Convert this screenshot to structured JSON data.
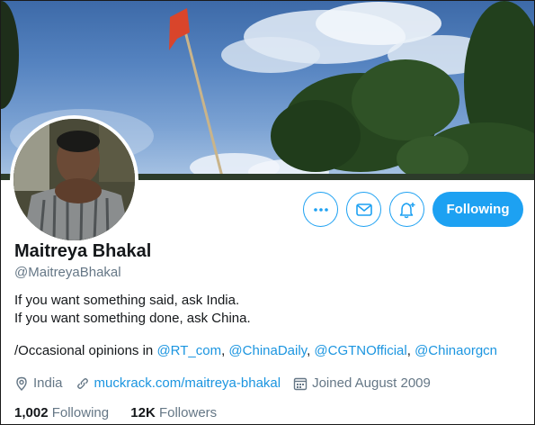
{
  "profile": {
    "name": "Maitreya Bhakal",
    "handle": "@MaitreyaBhakal",
    "bio_line1": "If you want something said, ask India.",
    "bio_line2": "If you want something done, ask China.",
    "bio_prefix": "/Occasional opinions in",
    "mentions": [
      "@RT_com",
      "@ChinaDaily",
      "@CGTNOfficial",
      "@Chinaorgcn"
    ],
    "location": "India",
    "website": "muckrack.com/maitreya-bhakal",
    "joined": "Joined August 2009"
  },
  "stats": {
    "following_count": "1,002",
    "following_label": "Following",
    "followers_count": "12K",
    "followers_label": "Followers"
  },
  "actions": {
    "following_label": "Following",
    "icons": [
      "more-icon",
      "mail-icon",
      "notification-bell-icon"
    ]
  },
  "colors": {
    "accent": "#1da1f2",
    "link": "#1b95e0",
    "secondary_text": "#657786",
    "primary_text": "#14171a"
  }
}
